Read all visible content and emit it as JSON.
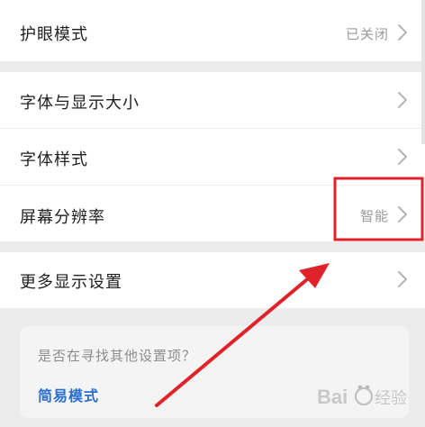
{
  "settings": {
    "eye_care": {
      "label": "护眼模式",
      "value": "已关闭"
    },
    "font_size": {
      "label": "字体与显示大小"
    },
    "font_style": {
      "label": "字体样式"
    },
    "resolution": {
      "label": "屏幕分辨率",
      "value": "智能"
    },
    "more_display": {
      "label": "更多显示设置"
    }
  },
  "suggestion_card": {
    "hint": "是否在寻找其他设置项？",
    "link": "简易模式"
  },
  "watermark": {
    "text": "Baidu 经验"
  },
  "annotation": {
    "highlight_color": "#e0222a",
    "arrow_color": "#e0222a"
  },
  "icons": {
    "chevron": "chevron-right-icon"
  }
}
